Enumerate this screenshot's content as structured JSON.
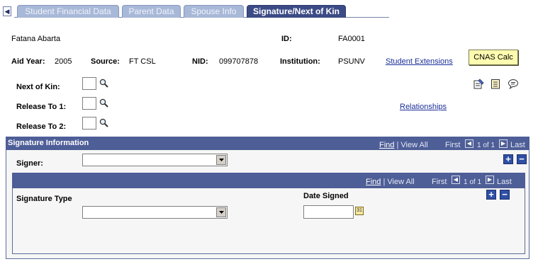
{
  "tabs": [
    {
      "label": "Student Financial Data",
      "active": false
    },
    {
      "label": "Parent Data",
      "active": false
    },
    {
      "label": "Spouse Info",
      "active": false
    },
    {
      "label": "Signature/Next of Kin",
      "active": true
    }
  ],
  "student": {
    "name": "Fatana Abarta",
    "id_label": "ID:",
    "id_value": "FA0001",
    "aid_year_label": "Aid Year:",
    "aid_year_value": "2005",
    "source_label": "Source:",
    "source_value": "FT CSL",
    "nid_label": "NID:",
    "nid_value": "099707878",
    "institution_label": "Institution:",
    "institution_value": "PSUNV",
    "student_extensions_link": "Student Extensions",
    "cnas_calc_button": "CNAS Calc"
  },
  "kin": {
    "next_of_kin_label": "Next of Kin:",
    "release_to_1_label": "Release To 1:",
    "release_to_2_label": "Release To 2:",
    "relationships_link": "Relationships",
    "next_of_kin_value": "",
    "release_to_1_value": "",
    "release_to_2_value": ""
  },
  "signature_grid": {
    "title": "Signature Information",
    "find": "Find",
    "view_all": "View All",
    "first": "First",
    "count": "1 of 1",
    "last": "Last",
    "signer_label": "Signer:",
    "signer_value": ""
  },
  "signature_type_grid": {
    "find": "Find",
    "view_all": "View All",
    "first": "First",
    "count": "1 of 1",
    "last": "Last",
    "signature_type_label": "Signature Type",
    "signature_type_value": "",
    "date_signed_label": "Date Signed",
    "date_signed_value": ""
  },
  "icons": {
    "lookup": "magnifier-icon",
    "calendar": "calendar-icon",
    "toolbar": [
      "edit-note-icon",
      "notepad-icon",
      "comment-icon"
    ]
  }
}
